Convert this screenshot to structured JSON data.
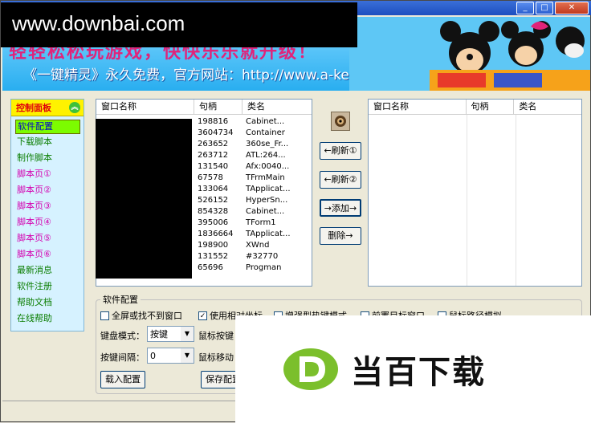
{
  "watermark_top": "www.downbai.com",
  "watermark_bottom": "当百下载",
  "banner": {
    "slogan1": "轻轻松松玩游戏，快快乐乐就升级！",
    "slogan2": "《一键精灵》永久免费，官方网站：http://www.a-key.net"
  },
  "window_buttons": {
    "min": "_",
    "max": "□",
    "close": "✕"
  },
  "sidebar": {
    "header": "控制面板",
    "items": [
      {
        "label": "软件配置"
      },
      {
        "label": "下载脚本"
      },
      {
        "label": "制作脚本"
      },
      {
        "label": "脚本页①"
      },
      {
        "label": "脚本页②"
      },
      {
        "label": "脚本页③"
      },
      {
        "label": "脚本页④"
      },
      {
        "label": "脚本页⑤"
      },
      {
        "label": "脚本页⑥"
      },
      {
        "label": "最新消息"
      },
      {
        "label": "软件注册"
      },
      {
        "label": "帮助文档"
      },
      {
        "label": "在线帮助"
      }
    ]
  },
  "left_list": {
    "headers": [
      "窗口名称",
      "句柄",
      "类名"
    ],
    "rows": [
      {
        "handle": "198816",
        "cls": "Cabinet..."
      },
      {
        "handle": "3604734",
        "cls": "Container"
      },
      {
        "handle": "263652",
        "cls": "360se_Fr..."
      },
      {
        "handle": "263712",
        "cls": "ATL:264..."
      },
      {
        "handle": "131540",
        "cls": "Afx:0040..."
      },
      {
        "handle": "67578",
        "cls": "TFrmMain"
      },
      {
        "handle": "133064",
        "cls": "TApplicat..."
      },
      {
        "handle": "526152",
        "cls": "HyperSn..."
      },
      {
        "handle": "854328",
        "cls": "Cabinet..."
      },
      {
        "handle": "395006",
        "cls": "TForm1"
      },
      {
        "handle": "1836664",
        "cls": "TApplicat..."
      },
      {
        "handle": "198900",
        "cls": "XWnd"
      },
      {
        "handle": "131552",
        "cls": "#32770"
      },
      {
        "handle": "65696",
        "cls": "Progman"
      }
    ]
  },
  "right_list": {
    "headers": [
      "窗口名称",
      "句柄",
      "类名"
    ]
  },
  "buttons": {
    "refresh1": "←刷新①",
    "refresh2": "←刷新②",
    "add": "→添加→",
    "delete": "删除→"
  },
  "config": {
    "title": "软件配置",
    "cb_fullscreen": "全屏或找不到窗口",
    "cb_relative": "使用相对坐标",
    "cb_hotkey": "增强型热键模式",
    "cb_front": "前置目标窗口",
    "cb_path": "鼠标路径模拟",
    "keyboard_mode_label": "键盘模式：",
    "keyboard_mode_value": "按键",
    "key_interval_label": "按键间隔：",
    "key_interval_value": "0",
    "mouse_key_label": "鼠标按键",
    "mouse_move_label": "鼠标移动",
    "load_button": "载入配置",
    "save_button": "保存配置"
  }
}
